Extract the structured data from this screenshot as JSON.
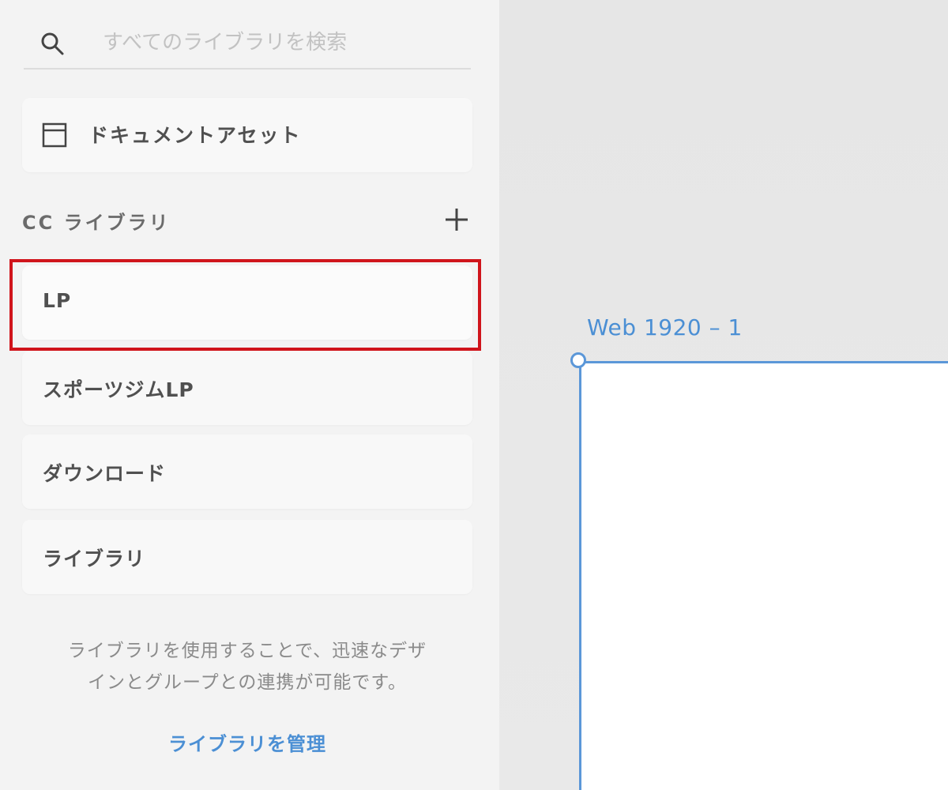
{
  "search": {
    "placeholder": "すべてのライブラリを検索",
    "icon": "search-icon"
  },
  "document_assets": {
    "label": "ドキュメントアセット",
    "icon": "document-icon"
  },
  "cc_libraries": {
    "title": "CC ライブラリ",
    "add_icon": "plus-icon",
    "items": [
      {
        "label": "LP",
        "highlighted": true
      },
      {
        "label": "スポーツジムLP"
      },
      {
        "label": "ダウンロード"
      },
      {
        "label": "ライブラリ"
      }
    ],
    "highlight_color": "#d0141b"
  },
  "info": {
    "line1": "ライブラリを使用することで、迅速なデザ",
    "line2": "インとグループとの連携が可能です。"
  },
  "manage_link": {
    "label": "ライブラリを管理",
    "color": "#4b8fd4"
  },
  "canvas": {
    "artboard_title": "Web 1920 – 1",
    "accent": "#5b97d8"
  }
}
